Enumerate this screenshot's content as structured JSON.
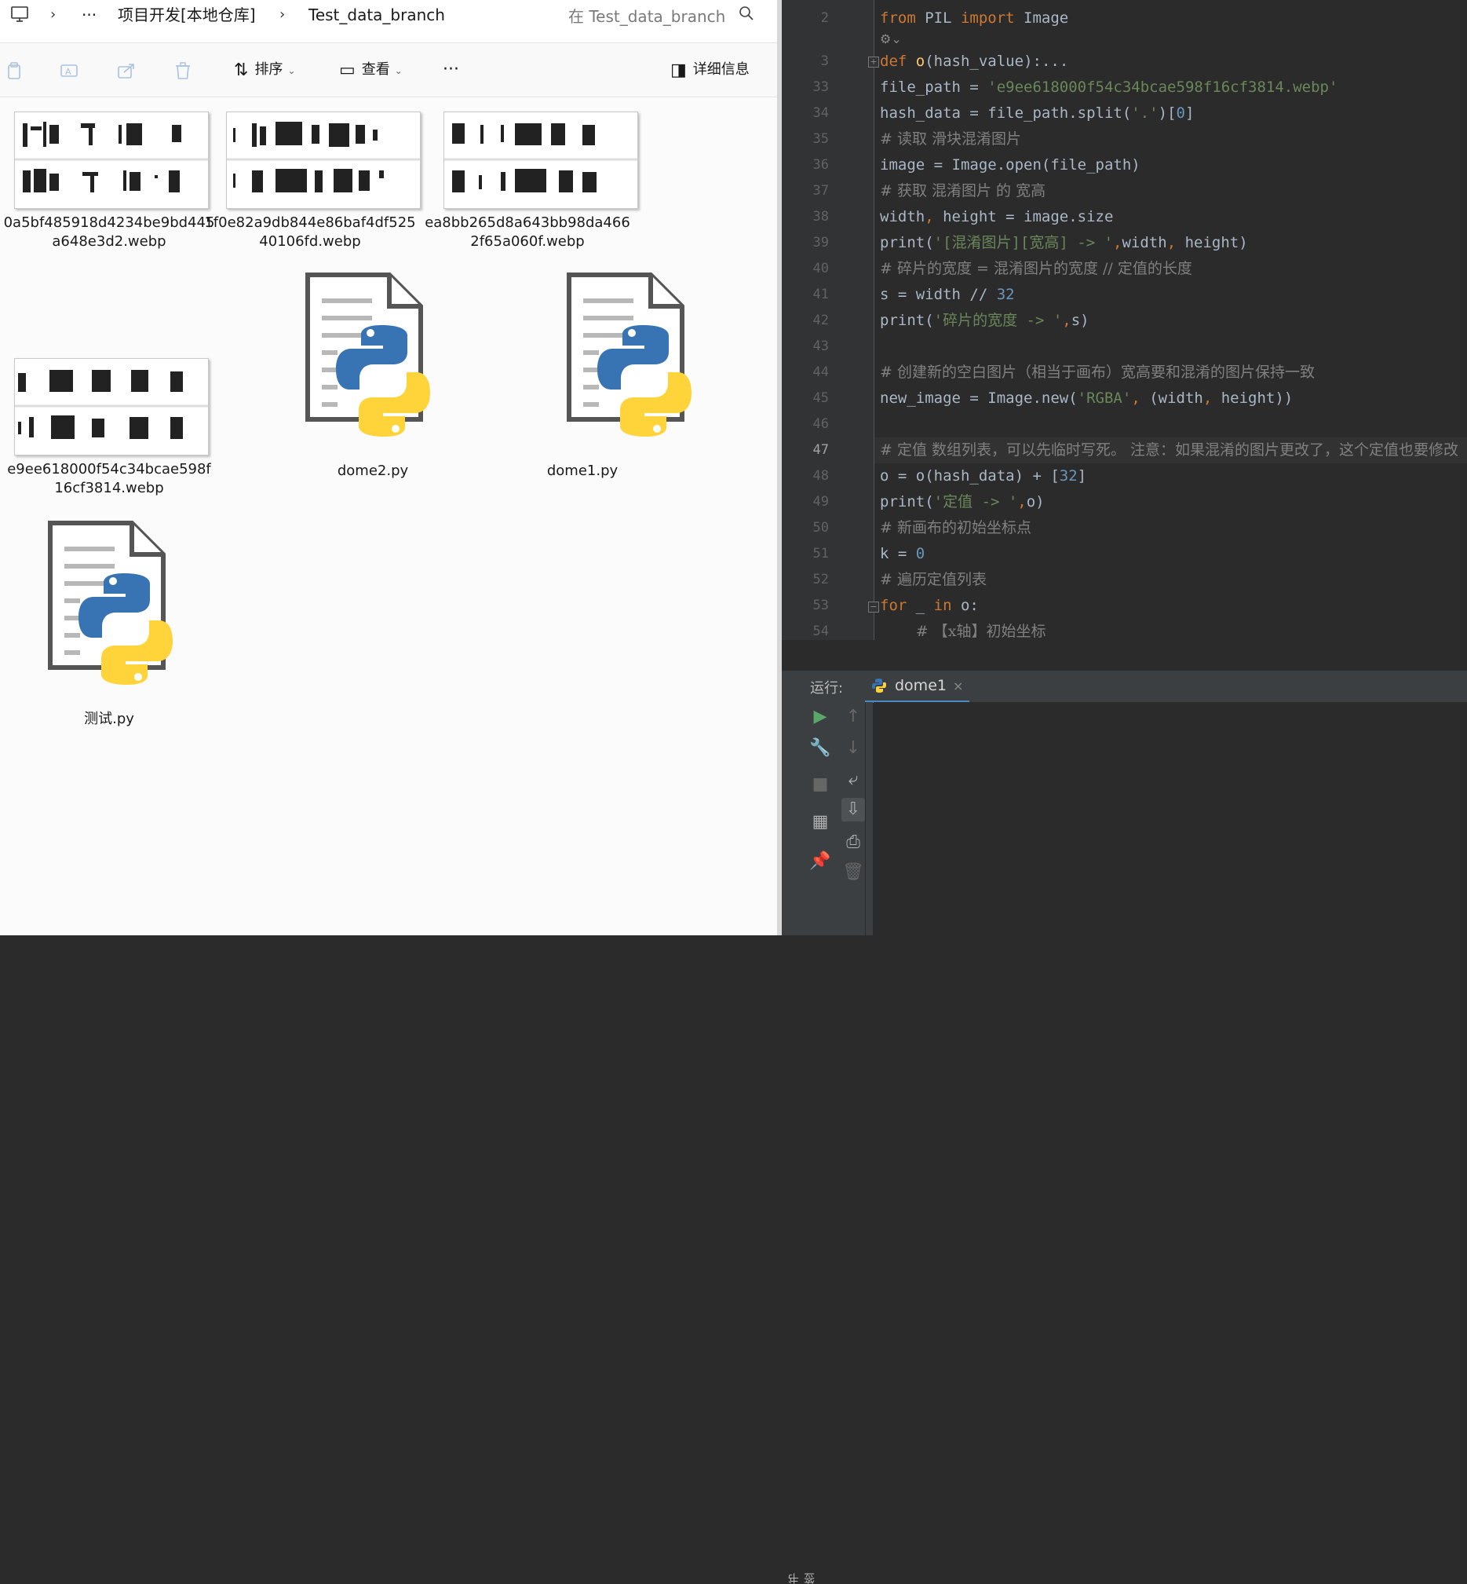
{
  "explorer": {
    "breadcrumb": [
      "项目开发[本地仓库]",
      "Test_data_branch"
    ],
    "more": "···",
    "search_placeholder": "在 Test_data_branch",
    "toolbar": {
      "sort_label": "排序",
      "view_label": "查看",
      "more": "···",
      "details_label": "详细信息"
    },
    "files": [
      {
        "name": "0a5bf485918d4234be9bd445a648e3d2.webp",
        "type": "webp"
      },
      {
        "name": "1f0e82a9db844e86baf4df52540106fd.webp",
        "type": "webp"
      },
      {
        "name": "ea8bb265d8a643bb98da4662f65a060f.webp",
        "type": "webp"
      },
      {
        "name": "e9ee618000f54c34bcae598f16cf3814.webp",
        "type": "webp"
      },
      {
        "name": "dome2.py",
        "type": "py"
      },
      {
        "name": "dome1.py",
        "type": "py"
      },
      {
        "name": "测试.py",
        "type": "py"
      }
    ]
  },
  "editor": {
    "line_numbers": [
      "2",
      "3",
      "33",
      "34",
      "35",
      "36",
      "37",
      "38",
      "39",
      "40",
      "41",
      "42",
      "43",
      "44",
      "45",
      "46",
      "47",
      "48",
      "49",
      "50",
      "51",
      "52",
      "53",
      "54"
    ],
    "current_line": "47",
    "lines": [
      "from PIL import Image",
      "def o(hash_value):...",
      "file_path = 'e9ee618000f54c34bcae598f16cf3814.webp'",
      "hash_data = file_path.split('.')[0]",
      "# 读取 滑块混淆图片",
      "image = Image.open(file_path)",
      "# 获取 混淆图片 的 宽高",
      "width, height = image.size",
      "print('[混淆图片][宽高] -> ',width, height)",
      "# 碎片的宽度 = 混淆图片的宽度 // 定值的长度",
      "s = width // 32",
      "print('碎片的宽度 -> ',s)",
      "",
      "# 创建新的空白图片（相当于画布）宽高要和混淆的图片保持一致",
      "new_image = Image.new('RGBA', (width, height))",
      "",
      "# 定值 数组列表，可以先临时写死。 注意：如果混淆的图片更改了，这个定值也要修改",
      "o = o(hash_data) + [32]",
      "print('定值 -> ',o)",
      "# 新画布的初始坐标点",
      "k = 0",
      "# 遍历定值列表",
      "for _ in o:",
      "    # 【x轴】初始坐标"
    ]
  },
  "run_panel": {
    "label": "运行:",
    "tab": "dome1",
    "close": "×",
    "structure_label": "书签"
  }
}
